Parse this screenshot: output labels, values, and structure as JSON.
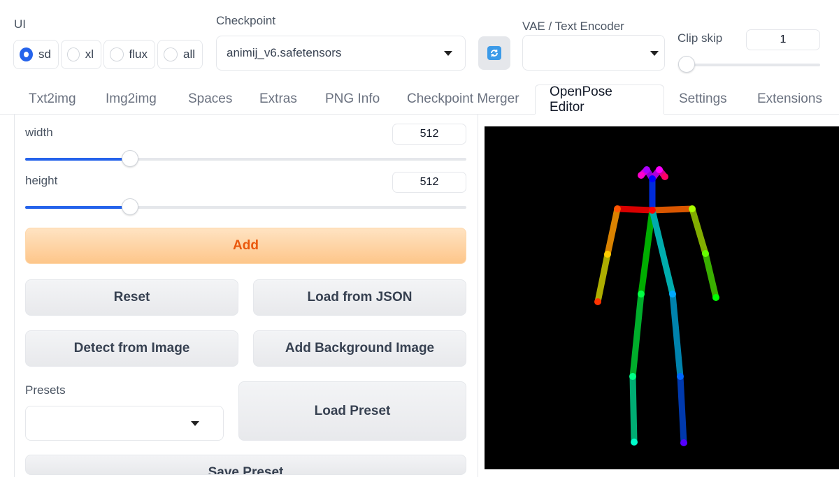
{
  "ui": {
    "label": "UI",
    "options": [
      {
        "label": "sd",
        "checked": true
      },
      {
        "label": "xl",
        "checked": false
      },
      {
        "label": "flux",
        "checked": false
      },
      {
        "label": "all",
        "checked": false
      }
    ]
  },
  "checkpoint": {
    "label": "Checkpoint",
    "value": "animij_v6.safetensors"
  },
  "vae": {
    "label": "VAE / Text Encoder",
    "value": ""
  },
  "clip_skip": {
    "label": "Clip skip",
    "value": "1",
    "fraction": 0.0
  },
  "tabs": [
    {
      "label": "Txt2img",
      "active": false
    },
    {
      "label": "Img2img",
      "active": false
    },
    {
      "label": "Spaces",
      "active": false
    },
    {
      "label": "Extras",
      "active": false
    },
    {
      "label": "PNG Info",
      "active": false
    },
    {
      "label": "Checkpoint Merger",
      "active": false
    },
    {
      "label": "OpenPose Editor",
      "active": true
    },
    {
      "label": "Settings",
      "active": false
    },
    {
      "label": "Extensions",
      "active": false
    }
  ],
  "editor": {
    "width": {
      "label": "width",
      "value": "512",
      "fraction": 0.238
    },
    "height": {
      "label": "height",
      "value": "512",
      "fraction": 0.238
    },
    "buttons": {
      "add": "Add",
      "reset": "Reset",
      "load_json": "Load from JSON",
      "detect": "Detect from Image",
      "add_bg": "Add Background Image",
      "load_preset": "Load Preset",
      "save_preset": "Save Preset"
    },
    "presets": {
      "label": "Presets",
      "value": ""
    }
  },
  "colors": {
    "accent": "#2563eb",
    "primary_text": "#ea580c",
    "canvas_bg": "#000000"
  }
}
